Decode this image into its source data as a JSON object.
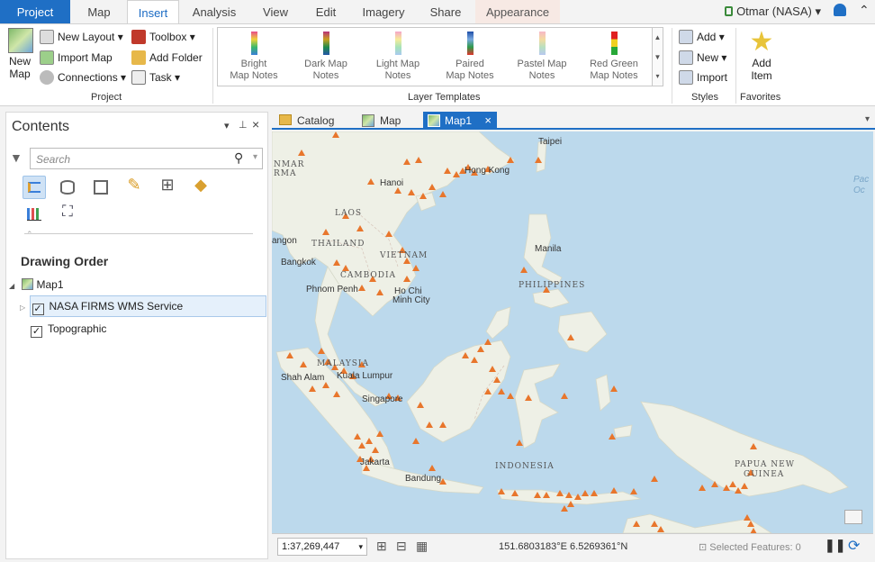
{
  "ribbon_tabs": [
    {
      "label": "Project"
    },
    {
      "label": "Map"
    },
    {
      "label": "Insert"
    },
    {
      "label": "Analysis"
    },
    {
      "label": "View"
    },
    {
      "label": "Edit"
    },
    {
      "label": "Imagery"
    },
    {
      "label": "Share"
    },
    {
      "label": "Appearance"
    }
  ],
  "user": {
    "name": "Otmar (NASA)"
  },
  "project_group": {
    "new_map": "New Map",
    "new_layout": "New Layout",
    "import_map": "Import Map",
    "connections": "Connections",
    "toolbox": "Toolbox",
    "add_folder": "Add Folder",
    "task": "Task",
    "label": "Project"
  },
  "layer_templates": {
    "label": "Layer Templates",
    "items": [
      {
        "line1": "Bright",
        "line2": "Map Notes"
      },
      {
        "line1": "Dark Map",
        "line2": "Notes"
      },
      {
        "line1": "Light Map",
        "line2": "Notes"
      },
      {
        "line1": "Paired",
        "line2": "Map Notes"
      },
      {
        "line1": "Pastel Map",
        "line2": "Notes"
      },
      {
        "line1": "Red Green",
        "line2": "Map Notes"
      }
    ]
  },
  "styles_group": {
    "add": "Add",
    "new": "New",
    "import": "Import",
    "label": "Styles"
  },
  "favorites_group": {
    "add_item": "Add Item",
    "label": "Favorites"
  },
  "contents": {
    "title": "Contents",
    "search_placeholder": "Search",
    "drawing_order": "Drawing Order",
    "map_name": "Map1",
    "layers": [
      {
        "name": "NASA FIRMS WMS Service",
        "checked": true
      },
      {
        "name": "Topographic",
        "checked": true
      }
    ]
  },
  "view_tabs": [
    {
      "label": "Catalog"
    },
    {
      "label": "Map"
    },
    {
      "label": "Map1"
    }
  ],
  "map_labels": {
    "taipei": "Taipei",
    "hong_kong": "Hong Kong",
    "hanoi": "Hanoi",
    "myanmar": "NMAR",
    "myanmar2": "RMA",
    "laos": "LAOS",
    "thailand": "THAILAND",
    "vietnam": "VIETNAM",
    "yangon": "angon",
    "bangkok": "Bangkok",
    "cambodia": "CAMBODIA",
    "phnom_penh": "Phnom Penh",
    "hcmc1": "Ho Chi",
    "hcmc2": "Minh City",
    "manila": "Manila",
    "philippines": "PHILIPPINES",
    "malaysia": "MALAYSIA",
    "kuala_lumpur": "Kuala Lumpur",
    "shah_alam": "Shah Alam",
    "singapore": "Singapore",
    "indonesia": "INDONESIA",
    "jakarta": "Jakarta",
    "bandung": "Bandung",
    "png1": "PAPUA NEW",
    "png2": "GUINEA",
    "pacific1": "Pac",
    "pacific2": "Oc"
  },
  "status": {
    "scale": "1:37,269,447",
    "coordinates": "151.6803183°E 6.5269361°N",
    "selected_features": "Selected Features: 0"
  },
  "colors": {
    "accent": "#1f6fc5",
    "fire_marker": "#e8762c",
    "water": "#bcd9ec",
    "land": "#eef0e6"
  }
}
